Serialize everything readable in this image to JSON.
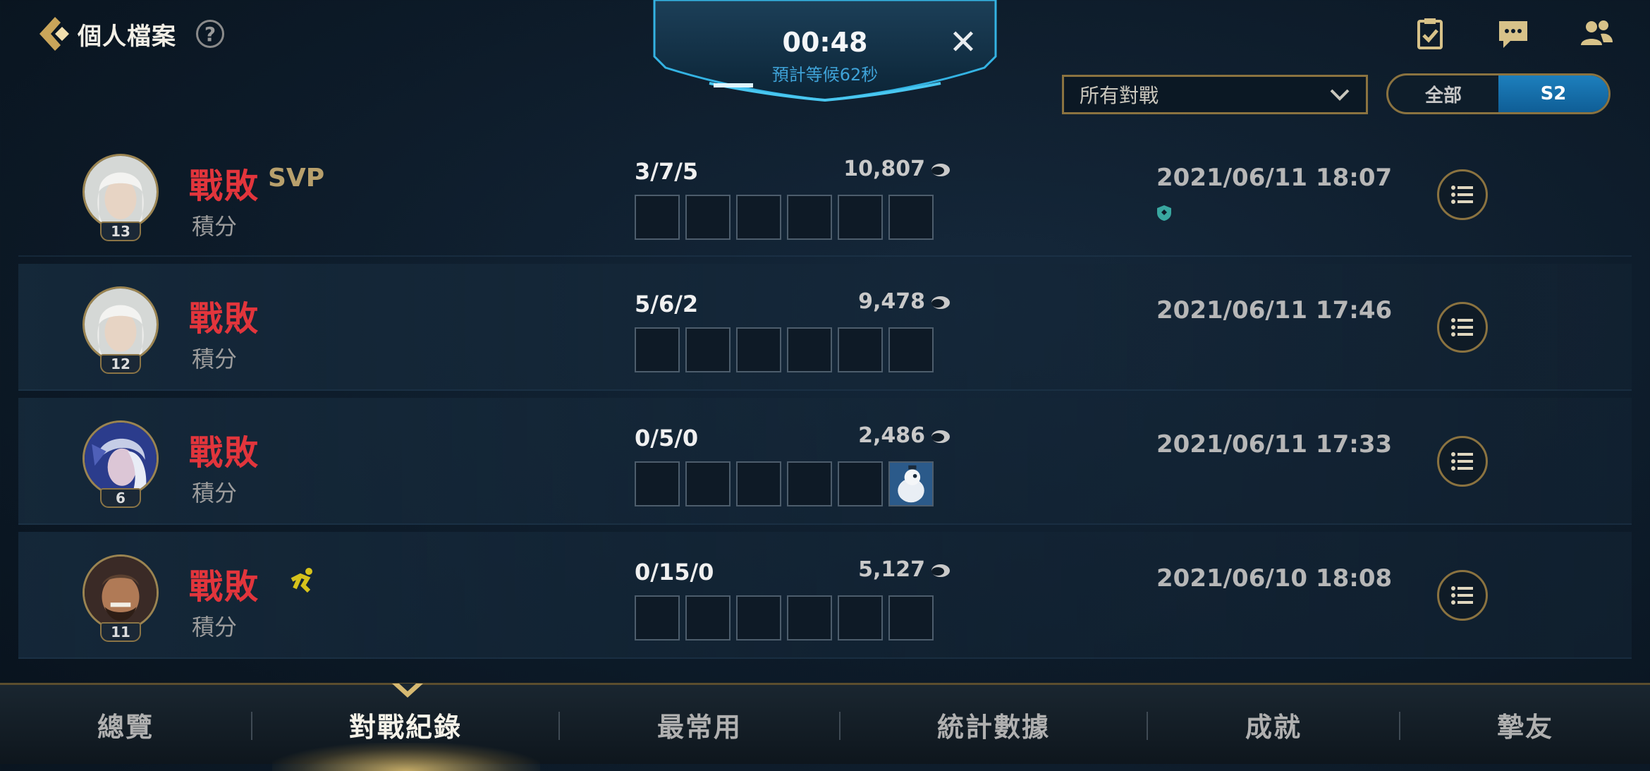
{
  "header": {
    "title": "個人檔案",
    "help": "?"
  },
  "queue": {
    "timer": "00:48",
    "estimate": "預計等候62秒",
    "close": "✕"
  },
  "filter": {
    "selected": "所有對戰"
  },
  "season_toggle": {
    "options": [
      "全部",
      "S2"
    ],
    "active": "S2"
  },
  "matches": [
    {
      "result": "戰敗",
      "badge": "SVP",
      "mode": "積分",
      "hero_level": "13",
      "kda": "3/7/5",
      "gold": "10,807",
      "datetime": "2021/06/11 18:07",
      "hero": "white-haired-hero"
    },
    {
      "result": "戰敗",
      "badge": "",
      "mode": "積分",
      "hero_level": "12",
      "kda": "5/6/2",
      "gold": "9,478",
      "datetime": "2021/06/11 17:46",
      "hero": "white-haired-hero"
    },
    {
      "result": "戰敗",
      "badge": "",
      "mode": "積分",
      "hero_level": "6",
      "kda": "0/5/0",
      "gold": "2,486",
      "datetime": "2021/06/11 17:33",
      "hero": "silver-haired-heroine"
    },
    {
      "result": "戰敗",
      "badge": "",
      "mode": "積分",
      "hero_level": "11",
      "kda": "0/15/0",
      "gold": "5,127",
      "datetime": "2021/06/10 18:08",
      "hero": "bearded-warrior"
    }
  ],
  "nav": {
    "tabs": [
      "總覽",
      "對戰紀錄",
      "最常用",
      "統計數據",
      "成就",
      "摯友"
    ],
    "active": "對戰紀錄"
  },
  "colors": {
    "defeat": "#e2353c",
    "gold_border": "#8b7340",
    "accent_blue": "#1d7fbd",
    "svp": "#b8a06c"
  }
}
